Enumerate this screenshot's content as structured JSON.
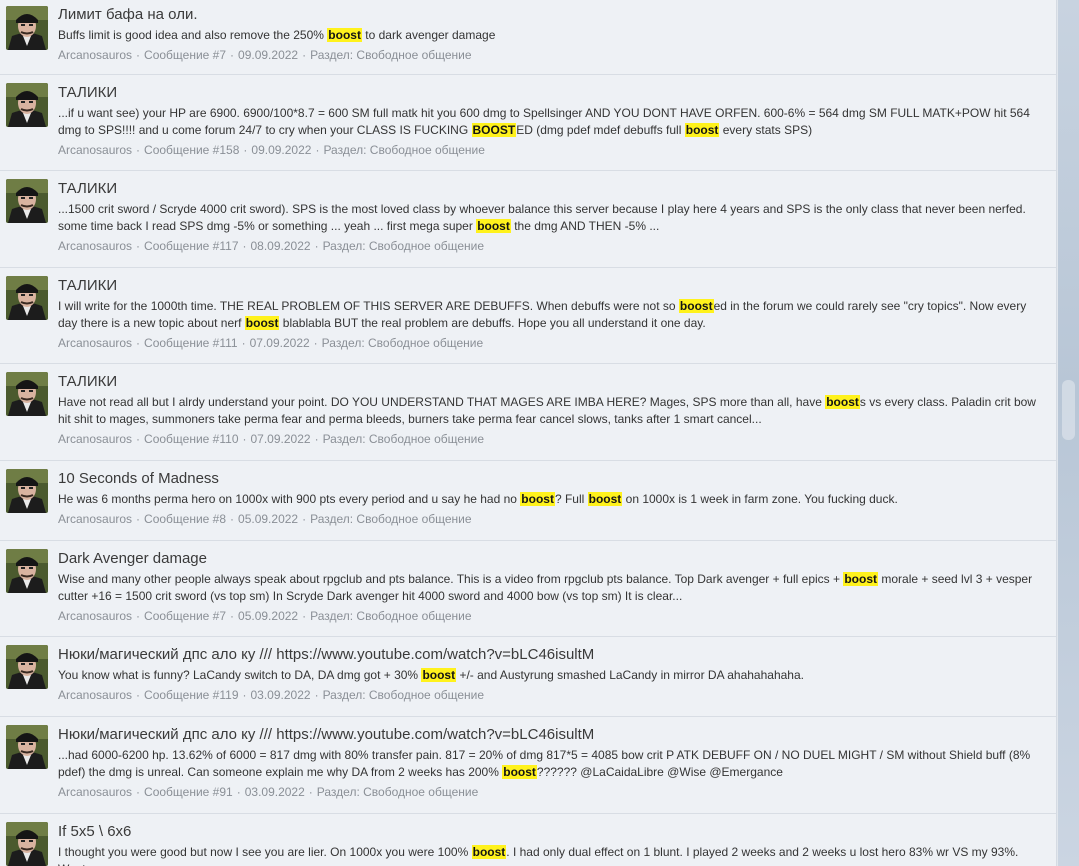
{
  "colors": {
    "highlight": "#fff21c",
    "meta": "#8a8f96",
    "title": "#3a3a3a"
  },
  "results": [
    {
      "title": "Лимит бафа на оли.",
      "snippet": [
        "Buffs limit is good idea and also remove the 250% ",
        {
          "h": "boost"
        },
        " to dark avenger damage"
      ],
      "author": "Arcanosauros",
      "post": "Сообщение #7",
      "date": "09.09.2022",
      "section": "Раздел: Свободное общение"
    },
    {
      "title": "ТАЛИКИ",
      "snippet": [
        "...if u want see) your HP are 6900. 6900/100*8.7 = 600 SM full matk hit you 600 dmg to Spellsinger AND YOU DONT HAVE ORFEN. 600-6% = 564 dmg SM FULL MATK+POW hit 564 dmg to SPS!!!! and u come forum 24/7 to cry when your CLASS IS FUCKING ",
        {
          "h": "BOOST"
        },
        "ED (dmg pdef mdef debuffs full ",
        {
          "h": "boost"
        },
        " every stats SPS)"
      ],
      "author": "Arcanosauros",
      "post": "Сообщение #158",
      "date": "09.09.2022",
      "section": "Раздел: Свободное общение"
    },
    {
      "title": "ТАЛИКИ",
      "snippet": [
        "...1500 crit sword / Scryde 4000 crit sword). SPS is the most loved class by whoever balance this server because I play here 4 years and SPS is the only class that never been nerfed. some time back I read SPS dmg -5% or something ... yeah ... first mega super ",
        {
          "h": "boost"
        },
        " the dmg AND THEN -5% ..."
      ],
      "author": "Arcanosauros",
      "post": "Сообщение #117",
      "date": "08.09.2022",
      "section": "Раздел: Свободное общение"
    },
    {
      "title": "ТАЛИКИ",
      "snippet": [
        "I will write for the 1000th time. THE REAL PROBLEM OF THIS SERVER ARE DEBUFFS. When debuffs were not so ",
        {
          "h": "boost"
        },
        "ed in the forum we could rarely see \"cry topics\". Now every day there is a new topic about nerf ",
        {
          "h": "boost"
        },
        " blablabla BUT the real problem are debuffs. Hope you all understand it one day."
      ],
      "author": "Arcanosauros",
      "post": "Сообщение #111",
      "date": "07.09.2022",
      "section": "Раздел: Свободное общение"
    },
    {
      "title": "ТАЛИКИ",
      "snippet": [
        "Have not read all but I alrdy understand your point. DO YOU UNDERSTAND THAT MAGES ARE IMBA HERE? Mages, SPS more than all, have ",
        {
          "h": "boost"
        },
        "s vs every class. Paladin crit bow hit shit to mages, summoners take perma fear and perma bleeds, burners take perma fear cancel slows, tanks after 1 smart cancel..."
      ],
      "author": "Arcanosauros",
      "post": "Сообщение #110",
      "date": "07.09.2022",
      "section": "Раздел: Свободное общение"
    },
    {
      "title": "10 Seconds of Madness",
      "snippet": [
        "He was 6 months perma hero on 1000x with 900 pts every period and u say he had no ",
        {
          "h": "boost"
        },
        "? Full ",
        {
          "h": "boost"
        },
        " on 1000x is 1 week in farm zone. You fucking duck."
      ],
      "author": "Arcanosauros",
      "post": "Сообщение #8",
      "date": "05.09.2022",
      "section": "Раздел: Свободное общение"
    },
    {
      "title": "Dark Avenger damage",
      "snippet": [
        "Wise and many other people always speak about rpgclub and pts balance. This is a video from rpgclub pts balance. Top Dark avenger + full epics + ",
        {
          "h": "boost"
        },
        " morale + seed lvl 3 + vesper cutter +16 = 1500 crit sword (vs top sm) In Scryde Dark avenger hit 4000 sword and 4000 bow (vs top sm) It is clear..."
      ],
      "author": "Arcanosauros",
      "post": "Сообщение #7",
      "date": "05.09.2022",
      "section": "Раздел: Свободное общение"
    },
    {
      "title": "Нюки/магический дпс ало ку /// https://www.youtube.com/watch?v=bLC46isultM",
      "snippet": [
        "You know what is funny? LaCandy switch to DA, DA dmg got + 30% ",
        {
          "h": "boost"
        },
        " +/- and Austyrung smashed LaCandy in mirror DA ahahahahaha."
      ],
      "author": "Arcanosauros",
      "post": "Сообщение #119",
      "date": "03.09.2022",
      "section": "Раздел: Свободное общение"
    },
    {
      "title": "Нюки/магический дпс ало ку /// https://www.youtube.com/watch?v=bLC46isultM",
      "snippet": [
        "...had 6000-6200 hp. 13.62% of 6000 = 817 dmg with 80% transfer pain. 817 = 20% of dmg 817*5 = 4085 bow crit P ATK DEBUFF ON / NO DUEL MIGHT / SM without Shield buff (8% pdef) the dmg is unreal. Can someone explain me why DA from 2 weeks has 200% ",
        {
          "h": "boost"
        },
        "?????? @LaCaidaLibre @Wise @Emergance"
      ],
      "author": "Arcanosauros",
      "post": "Сообщение #91",
      "date": "03.09.2022",
      "section": "Раздел: Свободное общение"
    },
    {
      "title": "If 5x5 \\ 6x6",
      "snippet": [
        "I thought you were good but now I see you are lier. On 1000x you were 100% ",
        {
          "h": "boost"
        },
        ". I had only dual effect on 1 blunt. I played 2 weeks and 2 weeks u lost hero 83% wr VS my 93%. Want see"
      ],
      "author": "",
      "post": "",
      "date": "",
      "section": ""
    }
  ]
}
